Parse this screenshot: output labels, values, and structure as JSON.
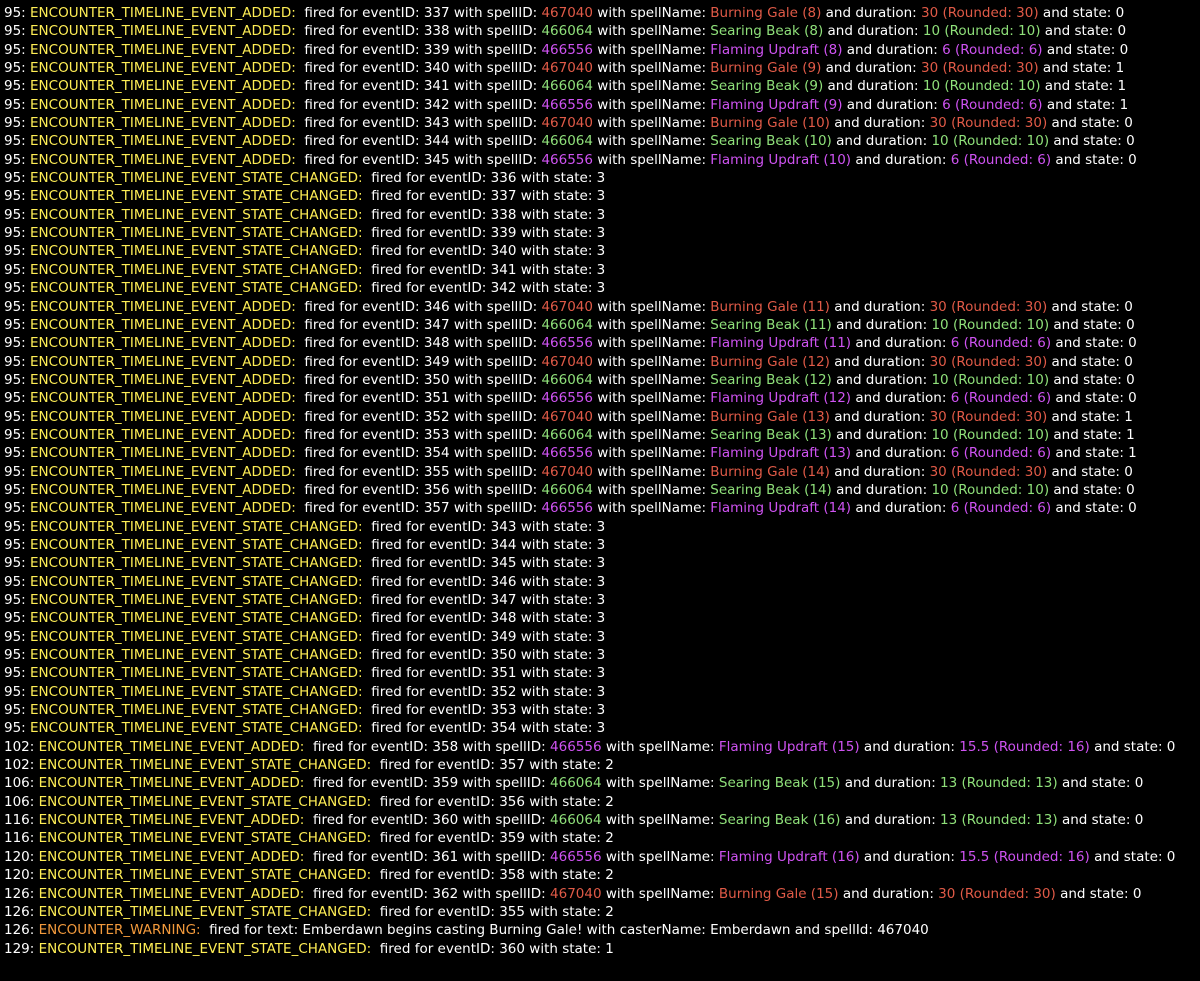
{
  "colors": {
    "background": "#000000",
    "text": "#ffffff",
    "event_name": "#ffee55",
    "warning_name": "#f39a3c",
    "burning_gale": "#e05a47",
    "searing_beak": "#8fe07a",
    "flaming_updraft": "#cf53f2"
  },
  "spells": {
    "467040": "burning",
    "466064": "searing",
    "466556": "flaming"
  },
  "lines": [
    {
      "t": "95",
      "ev": "ENCOUNTER_TIMELINE_EVENT_ADDED",
      "type": "added",
      "eid": "337",
      "sid": "467040",
      "name": "Burning Gale (8)",
      "dur": "30 (Rounded: 30)",
      "state": "0"
    },
    {
      "t": "95",
      "ev": "ENCOUNTER_TIMELINE_EVENT_ADDED",
      "type": "added",
      "eid": "338",
      "sid": "466064",
      "name": "Searing Beak (8)",
      "dur": "10 (Rounded: 10)",
      "state": "0"
    },
    {
      "t": "95",
      "ev": "ENCOUNTER_TIMELINE_EVENT_ADDED",
      "type": "added",
      "eid": "339",
      "sid": "466556",
      "name": "Flaming Updraft (8)",
      "dur": "6 (Rounded: 6)",
      "state": "0"
    },
    {
      "t": "95",
      "ev": "ENCOUNTER_TIMELINE_EVENT_ADDED",
      "type": "added",
      "eid": "340",
      "sid": "467040",
      "name": "Burning Gale (9)",
      "dur": "30 (Rounded: 30)",
      "state": "1"
    },
    {
      "t": "95",
      "ev": "ENCOUNTER_TIMELINE_EVENT_ADDED",
      "type": "added",
      "eid": "341",
      "sid": "466064",
      "name": "Searing Beak (9)",
      "dur": "10 (Rounded: 10)",
      "state": "1"
    },
    {
      "t": "95",
      "ev": "ENCOUNTER_TIMELINE_EVENT_ADDED",
      "type": "added",
      "eid": "342",
      "sid": "466556",
      "name": "Flaming Updraft (9)",
      "dur": "6 (Rounded: 6)",
      "state": "1"
    },
    {
      "t": "95",
      "ev": "ENCOUNTER_TIMELINE_EVENT_ADDED",
      "type": "added",
      "eid": "343",
      "sid": "467040",
      "name": "Burning Gale (10)",
      "dur": "30 (Rounded: 30)",
      "state": "0"
    },
    {
      "t": "95",
      "ev": "ENCOUNTER_TIMELINE_EVENT_ADDED",
      "type": "added",
      "eid": "344",
      "sid": "466064",
      "name": "Searing Beak (10)",
      "dur": "10 (Rounded: 10)",
      "state": "0"
    },
    {
      "t": "95",
      "ev": "ENCOUNTER_TIMELINE_EVENT_ADDED",
      "type": "added",
      "eid": "345",
      "sid": "466556",
      "name": "Flaming Updraft (10)",
      "dur": "6 (Rounded: 6)",
      "state": "0"
    },
    {
      "t": "95",
      "ev": "ENCOUNTER_TIMELINE_EVENT_STATE_CHANGED",
      "type": "state",
      "eid": "336",
      "state": "3"
    },
    {
      "t": "95",
      "ev": "ENCOUNTER_TIMELINE_EVENT_STATE_CHANGED",
      "type": "state",
      "eid": "337",
      "state": "3"
    },
    {
      "t": "95",
      "ev": "ENCOUNTER_TIMELINE_EVENT_STATE_CHANGED",
      "type": "state",
      "eid": "338",
      "state": "3"
    },
    {
      "t": "95",
      "ev": "ENCOUNTER_TIMELINE_EVENT_STATE_CHANGED",
      "type": "state",
      "eid": "339",
      "state": "3"
    },
    {
      "t": "95",
      "ev": "ENCOUNTER_TIMELINE_EVENT_STATE_CHANGED",
      "type": "state",
      "eid": "340",
      "state": "3"
    },
    {
      "t": "95",
      "ev": "ENCOUNTER_TIMELINE_EVENT_STATE_CHANGED",
      "type": "state",
      "eid": "341",
      "state": "3"
    },
    {
      "t": "95",
      "ev": "ENCOUNTER_TIMELINE_EVENT_STATE_CHANGED",
      "type": "state",
      "eid": "342",
      "state": "3"
    },
    {
      "t": "95",
      "ev": "ENCOUNTER_TIMELINE_EVENT_ADDED",
      "type": "added",
      "eid": "346",
      "sid": "467040",
      "name": "Burning Gale (11)",
      "dur": "30 (Rounded: 30)",
      "state": "0"
    },
    {
      "t": "95",
      "ev": "ENCOUNTER_TIMELINE_EVENT_ADDED",
      "type": "added",
      "eid": "347",
      "sid": "466064",
      "name": "Searing Beak (11)",
      "dur": "10 (Rounded: 10)",
      "state": "0"
    },
    {
      "t": "95",
      "ev": "ENCOUNTER_TIMELINE_EVENT_ADDED",
      "type": "added",
      "eid": "348",
      "sid": "466556",
      "name": "Flaming Updraft (11)",
      "dur": "6 (Rounded: 6)",
      "state": "0"
    },
    {
      "t": "95",
      "ev": "ENCOUNTER_TIMELINE_EVENT_ADDED",
      "type": "added",
      "eid": "349",
      "sid": "467040",
      "name": "Burning Gale (12)",
      "dur": "30 (Rounded: 30)",
      "state": "0"
    },
    {
      "t": "95",
      "ev": "ENCOUNTER_TIMELINE_EVENT_ADDED",
      "type": "added",
      "eid": "350",
      "sid": "466064",
      "name": "Searing Beak (12)",
      "dur": "10 (Rounded: 10)",
      "state": "0"
    },
    {
      "t": "95",
      "ev": "ENCOUNTER_TIMELINE_EVENT_ADDED",
      "type": "added",
      "eid": "351",
      "sid": "466556",
      "name": "Flaming Updraft (12)",
      "dur": "6 (Rounded: 6)",
      "state": "0"
    },
    {
      "t": "95",
      "ev": "ENCOUNTER_TIMELINE_EVENT_ADDED",
      "type": "added",
      "eid": "352",
      "sid": "467040",
      "name": "Burning Gale (13)",
      "dur": "30 (Rounded: 30)",
      "state": "1"
    },
    {
      "t": "95",
      "ev": "ENCOUNTER_TIMELINE_EVENT_ADDED",
      "type": "added",
      "eid": "353",
      "sid": "466064",
      "name": "Searing Beak (13)",
      "dur": "10 (Rounded: 10)",
      "state": "1"
    },
    {
      "t": "95",
      "ev": "ENCOUNTER_TIMELINE_EVENT_ADDED",
      "type": "added",
      "eid": "354",
      "sid": "466556",
      "name": "Flaming Updraft (13)",
      "dur": "6 (Rounded: 6)",
      "state": "1"
    },
    {
      "t": "95",
      "ev": "ENCOUNTER_TIMELINE_EVENT_ADDED",
      "type": "added",
      "eid": "355",
      "sid": "467040",
      "name": "Burning Gale (14)",
      "dur": "30 (Rounded: 30)",
      "state": "0"
    },
    {
      "t": "95",
      "ev": "ENCOUNTER_TIMELINE_EVENT_ADDED",
      "type": "added",
      "eid": "356",
      "sid": "466064",
      "name": "Searing Beak (14)",
      "dur": "10 (Rounded: 10)",
      "state": "0"
    },
    {
      "t": "95",
      "ev": "ENCOUNTER_TIMELINE_EVENT_ADDED",
      "type": "added",
      "eid": "357",
      "sid": "466556",
      "name": "Flaming Updraft (14)",
      "dur": "6 (Rounded: 6)",
      "state": "0"
    },
    {
      "t": "95",
      "ev": "ENCOUNTER_TIMELINE_EVENT_STATE_CHANGED",
      "type": "state",
      "eid": "343",
      "state": "3"
    },
    {
      "t": "95",
      "ev": "ENCOUNTER_TIMELINE_EVENT_STATE_CHANGED",
      "type": "state",
      "eid": "344",
      "state": "3"
    },
    {
      "t": "95",
      "ev": "ENCOUNTER_TIMELINE_EVENT_STATE_CHANGED",
      "type": "state",
      "eid": "345",
      "state": "3"
    },
    {
      "t": "95",
      "ev": "ENCOUNTER_TIMELINE_EVENT_STATE_CHANGED",
      "type": "state",
      "eid": "346",
      "state": "3"
    },
    {
      "t": "95",
      "ev": "ENCOUNTER_TIMELINE_EVENT_STATE_CHANGED",
      "type": "state",
      "eid": "347",
      "state": "3"
    },
    {
      "t": "95",
      "ev": "ENCOUNTER_TIMELINE_EVENT_STATE_CHANGED",
      "type": "state",
      "eid": "348",
      "state": "3"
    },
    {
      "t": "95",
      "ev": "ENCOUNTER_TIMELINE_EVENT_STATE_CHANGED",
      "type": "state",
      "eid": "349",
      "state": "3"
    },
    {
      "t": "95",
      "ev": "ENCOUNTER_TIMELINE_EVENT_STATE_CHANGED",
      "type": "state",
      "eid": "350",
      "state": "3"
    },
    {
      "t": "95",
      "ev": "ENCOUNTER_TIMELINE_EVENT_STATE_CHANGED",
      "type": "state",
      "eid": "351",
      "state": "3"
    },
    {
      "t": "95",
      "ev": "ENCOUNTER_TIMELINE_EVENT_STATE_CHANGED",
      "type": "state",
      "eid": "352",
      "state": "3"
    },
    {
      "t": "95",
      "ev": "ENCOUNTER_TIMELINE_EVENT_STATE_CHANGED",
      "type": "state",
      "eid": "353",
      "state": "3"
    },
    {
      "t": "95",
      "ev": "ENCOUNTER_TIMELINE_EVENT_STATE_CHANGED",
      "type": "state",
      "eid": "354",
      "state": "3"
    },
    {
      "t": "102",
      "ev": "ENCOUNTER_TIMELINE_EVENT_ADDED",
      "type": "added",
      "eid": "358",
      "sid": "466556",
      "name": "Flaming Updraft (15)",
      "dur": "15.5 (Rounded: 16)",
      "state": "0"
    },
    {
      "t": "102",
      "ev": "ENCOUNTER_TIMELINE_EVENT_STATE_CHANGED",
      "type": "state",
      "eid": "357",
      "state": "2"
    },
    {
      "t": "106",
      "ev": "ENCOUNTER_TIMELINE_EVENT_ADDED",
      "type": "added",
      "eid": "359",
      "sid": "466064",
      "name": "Searing Beak (15)",
      "dur": "13 (Rounded: 13)",
      "state": "0"
    },
    {
      "t": "106",
      "ev": "ENCOUNTER_TIMELINE_EVENT_STATE_CHANGED",
      "type": "state",
      "eid": "356",
      "state": "2"
    },
    {
      "t": "116",
      "ev": "ENCOUNTER_TIMELINE_EVENT_ADDED",
      "type": "added",
      "eid": "360",
      "sid": "466064",
      "name": "Searing Beak (16)",
      "dur": "13 (Rounded: 13)",
      "state": "0"
    },
    {
      "t": "116",
      "ev": "ENCOUNTER_TIMELINE_EVENT_STATE_CHANGED",
      "type": "state",
      "eid": "359",
      "state": "2"
    },
    {
      "t": "120",
      "ev": "ENCOUNTER_TIMELINE_EVENT_ADDED",
      "type": "added",
      "eid": "361",
      "sid": "466556",
      "name": "Flaming Updraft (16)",
      "dur": "15.5 (Rounded: 16)",
      "state": "0"
    },
    {
      "t": "120",
      "ev": "ENCOUNTER_TIMELINE_EVENT_STATE_CHANGED",
      "type": "state",
      "eid": "358",
      "state": "2"
    },
    {
      "t": "126",
      "ev": "ENCOUNTER_TIMELINE_EVENT_ADDED",
      "type": "added",
      "eid": "362",
      "sid": "467040",
      "name": "Burning Gale (15)",
      "dur": "30 (Rounded: 30)",
      "state": "0"
    },
    {
      "t": "126",
      "ev": "ENCOUNTER_TIMELINE_EVENT_STATE_CHANGED",
      "type": "state",
      "eid": "355",
      "state": "2"
    },
    {
      "t": "126",
      "ev": "ENCOUNTER_WARNING",
      "type": "warning",
      "text": "Emberdawn begins casting Burning Gale!",
      "caster": "Emberdawn",
      "sid": "467040"
    },
    {
      "t": "129",
      "ev": "ENCOUNTER_TIMELINE_EVENT_STATE_CHANGED",
      "type": "state",
      "eid": "360",
      "state": "1"
    }
  ]
}
